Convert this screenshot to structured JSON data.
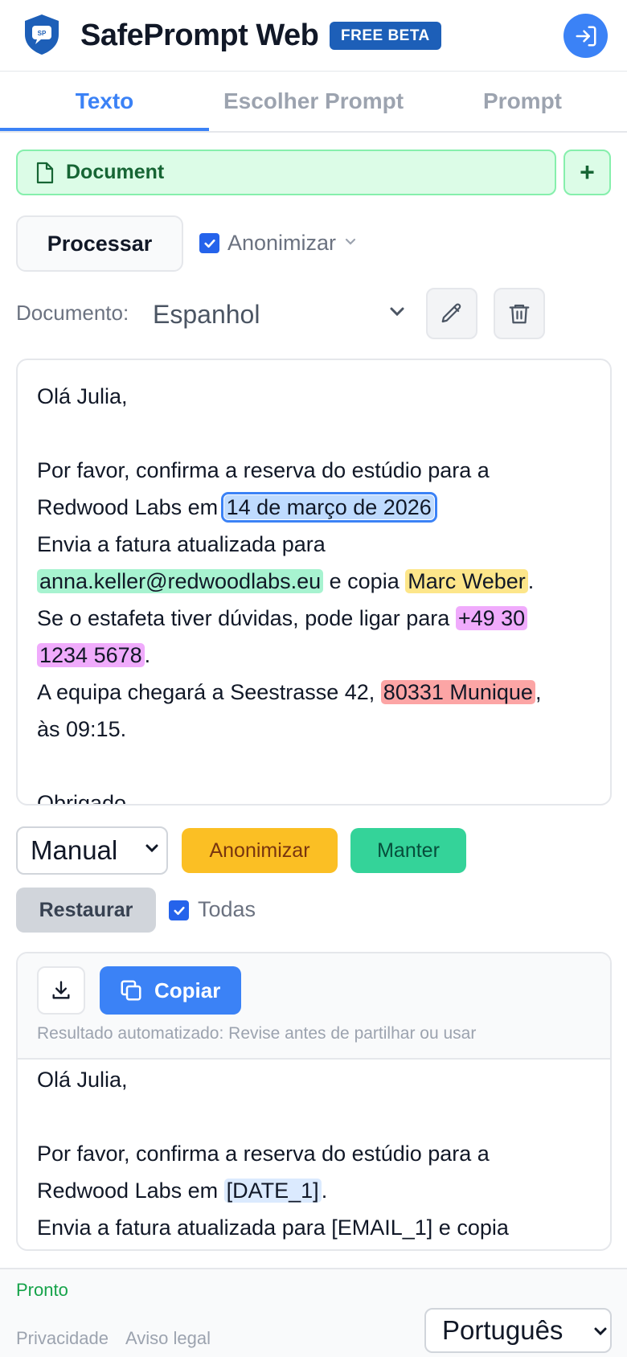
{
  "header": {
    "title": "SafePrompt Web",
    "badge": "FREE BETA",
    "logo_text": "SP",
    "login_icon": "login-icon"
  },
  "tabs": [
    {
      "label": "Texto",
      "active": true
    },
    {
      "label": "Escolher Prompt",
      "active": false
    },
    {
      "label": "Prompt",
      "active": false
    }
  ],
  "document": {
    "button_label": "Document",
    "add_label": "+"
  },
  "process": {
    "button_label": "Processar",
    "anonymize_label": "Anonimizar",
    "anonymize_checked": true
  },
  "language_row": {
    "label": "Documento:",
    "selected": "Espanhol"
  },
  "editor": {
    "greeting": "Olá Julia,",
    "l2a": "Por favor, confirma a reserva do estúdio para a",
    "l3a": "Redwood Labs em ",
    "date": "14 de março de 2026",
    "l4a": "Envia a fatura atualizada para",
    "email": "anna.keller@redwoodlabs.eu",
    "l5b": " e copia ",
    "name": "Marc Weber",
    "l5c": ".",
    "l6a": "Se o estafeta tiver dúvidas, pode ligar para ",
    "phone_a": "+49 30 ",
    "phone_b": "1234 5678",
    "l7b": ".",
    "l8a": "A equipa chegará a Seestrasse 42, ",
    "city": "80331 Munique",
    "l8c": ",",
    "l9a": "às 09:15.",
    "thanks": "Obrigado"
  },
  "controls": {
    "mode_selected": "Manual",
    "anonymize_button": "Anonimizar",
    "keep_button": "Manter",
    "restore_button": "Restaurar",
    "all_label": "Todas",
    "all_checked": true
  },
  "output": {
    "copy_label": "Copiar",
    "note": "Resultado automatizado: Revise antes de partilhar ou usar",
    "greeting": "Olá Julia,",
    "l2": "Por favor, confirma a reserva do estúdio para a",
    "l3a": "Redwood Labs em ",
    "date_placeholder": "[DATE_1]",
    "l3c": ".",
    "l4": "Envia a fatura atualizada para [EMAIL_1] e copia"
  },
  "footer": {
    "status": "Pronto",
    "privacy": "Privacidade",
    "legal": "Aviso legal",
    "ui_language": "Português"
  },
  "colors": {
    "accent": "#3b82f6",
    "badge": "#1d5fb8",
    "document_green": "#dcfce7",
    "anonymize_yellow": "#fbbf24",
    "keep_green": "#34d399",
    "highlight_date": "#bfdbfe",
    "highlight_email": "#a7f3d0",
    "highlight_name": "#fde68a",
    "highlight_phone": "#f0abfc",
    "highlight_address": "#fca5a5"
  }
}
